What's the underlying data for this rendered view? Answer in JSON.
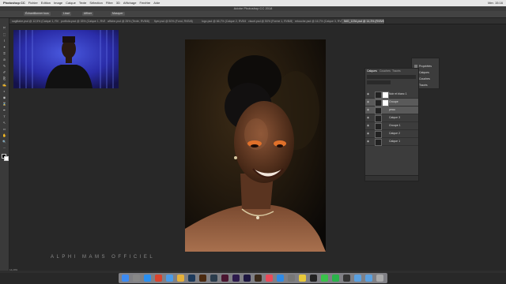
{
  "menubar": {
    "apple": "",
    "items": [
      "Photoshop CC",
      "Fichier",
      "Edition",
      "Image",
      "Calque",
      "Texte",
      "Sélection",
      "Filtre",
      "3D",
      "Affichage",
      "Fenêtre",
      "Aide"
    ],
    "clock": "Mer. 15:16"
  },
  "titlebar": {
    "title": "Adobe Photoshop CC 2018"
  },
  "options": {
    "btn1": "Échantillonner tous",
    "btn2": "Lissé",
    "btn3": "Affiner",
    "btn4": "Masquer"
  },
  "tabs": [
    {
      "label": "sagittaire.psd @ 12,5% (Calque 1, RVB/8)",
      "active": false
    },
    {
      "label": "portfolio.psd @ 33% (Calque 1, RVB/8)",
      "active": false
    },
    {
      "label": "affiche.psd @ 25% (Texte, RVB/8)",
      "active": false
    },
    {
      "label": "flyer.psd @ 50% (Fond, RVB/8)",
      "active": false
    },
    {
      "label": "logo.psd @ 66,7% (Calque 2, RVB/8)",
      "active": false
    },
    {
      "label": "visuel.psd @ 50% (Forme 1, RVB/8)",
      "active": false
    },
    {
      "label": "retouche.psd @ 16,7% (Calque 3, RVB/8)",
      "active": false
    },
    {
      "label": "IMG_1234.psd @ 14,3% (RVB/8)",
      "active": true
    }
  ],
  "tools": [
    "⤧",
    "⬚",
    "⌇",
    "✦",
    "⌗",
    "⊘",
    "✎",
    "✐",
    "⎘",
    "✍",
    "◐",
    "◉",
    "⌛",
    "✒",
    "T",
    "↖",
    "▭",
    "✋",
    "🔍",
    "⋯"
  ],
  "watermark": "ALPHI MAMS OFFICIEL",
  "status": {
    "zoom": "14,29%"
  },
  "layers_panel": {
    "tabs": [
      "Calques",
      "Couches",
      "Tracés"
    ],
    "layers": [
      {
        "name": "Noir et blanc 1",
        "visible": true,
        "mask": true,
        "selected": false
      },
      {
        "name": "Groupe",
        "visible": true,
        "mask": true,
        "selected": true
      },
      {
        "name": "peau",
        "visible": true,
        "mask": false,
        "selected": true
      },
      {
        "name": "Calque 3",
        "visible": true,
        "mask": false,
        "selected": false
      },
      {
        "name": "Groupe 1",
        "visible": true,
        "mask": false,
        "selected": false
      },
      {
        "name": "Calque 2",
        "visible": true,
        "mask": false,
        "selected": false
      },
      {
        "name": "Calque 1",
        "visible": true,
        "mask": false,
        "selected": false
      }
    ]
  },
  "properties_panel": {
    "items": [
      "Propriétés",
      "Calques",
      "Couches",
      "Tracés"
    ]
  },
  "dock": {
    "icons": [
      {
        "name": "Finder",
        "color": "#3d8bf2"
      },
      {
        "name": "Launchpad",
        "color": "#888"
      },
      {
        "name": "Safari",
        "color": "#2a8ff0"
      },
      {
        "name": "Chrome",
        "color": "#d9442e"
      },
      {
        "name": "Mail",
        "color": "#4a9be8"
      },
      {
        "name": "Photos",
        "color": "#e6b13a"
      },
      {
        "name": "Ps",
        "color": "#1d3a5c"
      },
      {
        "name": "Ai",
        "color": "#4b2a10"
      },
      {
        "name": "Lr",
        "color": "#2b3c4c"
      },
      {
        "name": "Id",
        "color": "#4a1530"
      },
      {
        "name": "Pr",
        "color": "#2d1a4c"
      },
      {
        "name": "Ae",
        "color": "#1d1640"
      },
      {
        "name": "Br",
        "color": "#3a2a1a"
      },
      {
        "name": "Music",
        "color": "#ea4a5a"
      },
      {
        "name": "App Store",
        "color": "#2e8ae6"
      },
      {
        "name": "Préférences",
        "color": "#777"
      },
      {
        "name": "Notes",
        "color": "#e8c93a"
      },
      {
        "name": "Terminal",
        "color": "#222"
      },
      {
        "name": "Messages",
        "color": "#3ac24a"
      },
      {
        "name": "FaceTime",
        "color": "#2ab34a"
      },
      {
        "name": "OBS",
        "color": "#333"
      },
      {
        "name": "Dossier",
        "color": "#5aa0e0"
      },
      {
        "name": "Téléchargements",
        "color": "#5aa0e0"
      },
      {
        "name": "Corbeille",
        "color": "#aaa"
      }
    ]
  }
}
